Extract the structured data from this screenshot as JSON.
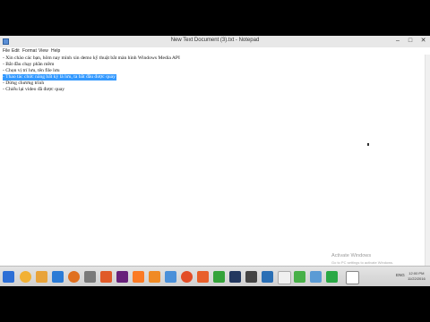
{
  "window": {
    "title": "New Text Document (3).txt - Notepad",
    "controls": {
      "minimize": "–",
      "maximize": "□",
      "close": "✕"
    }
  },
  "menu": [
    "File",
    "Edit",
    "Format",
    "View",
    "Help"
  ],
  "document": {
    "lines": [
      "- Xin chào các bạn, hôm nay mình xin demo kỹ thuật bắt màn hình Windows Media API",
      "- Bắt đầu chạy phần mềm",
      "- Chọn vị trí lưu, tên file lưu",
      "- Thao tác chức năng bất kỳ là lưu, ta bắt đầu được quay",
      "- Dừng chương trình",
      "- Chiếu lại video đã được quay"
    ],
    "selected_line_index": 3
  },
  "watermark": {
    "title": "Activate Windows",
    "subtitle": "Go to PC settings to activate Windows."
  },
  "taskbar": {
    "icons": [
      "start-icon",
      "ie-icon",
      "chrome-icon",
      "firefox-icon",
      "folder-icon",
      "explorer-icon",
      "media-player-icon",
      "visual-studio-icon",
      "xampp-icon",
      "vlc-icon",
      "firefox-dev-icon",
      "paint-icon",
      "dreamweaver-icon",
      "photoshop-icon",
      "terminal-icon",
      "notepad-icon",
      "skype-icon",
      "camtasia-icon",
      "notepad-active-icon"
    ],
    "tray_language": "ENG",
    "clock_time": "12:00 PM",
    "clock_date": "11/22/2016"
  },
  "colors": {
    "selection": "#3399ff",
    "taskbar": "#d6d6d6"
  }
}
